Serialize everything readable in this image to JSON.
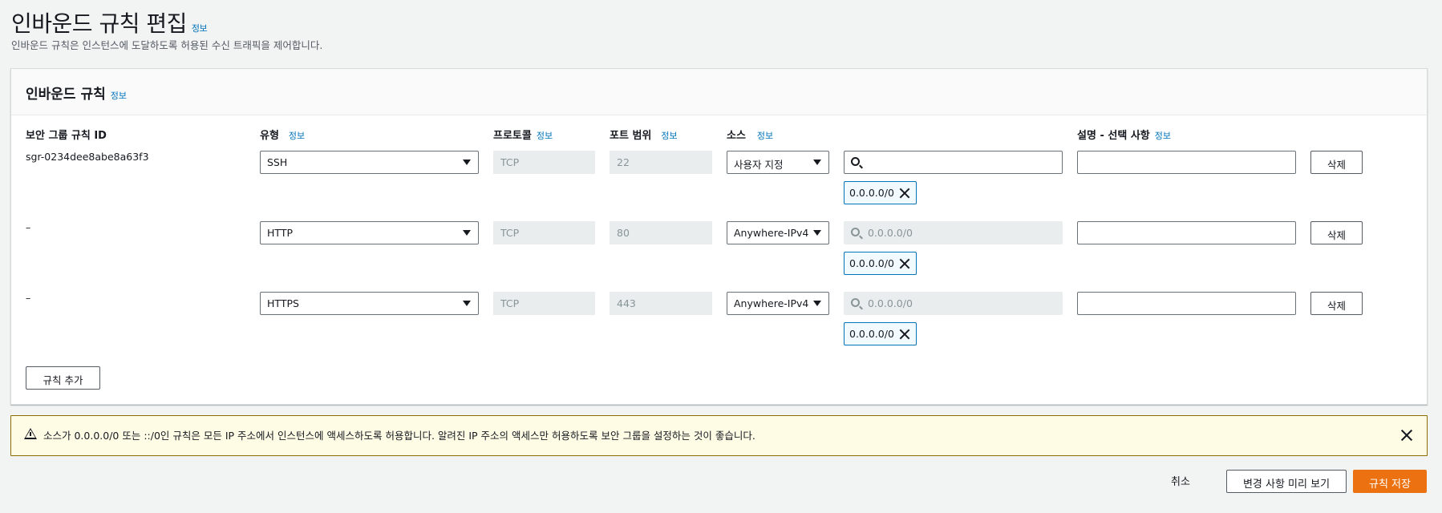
{
  "header": {
    "title": "인바운드 규칙 편집",
    "info": "정보",
    "description": "인바운드 규칙은 인스턴스에 도달하도록 허용된 수신 트래픽을 제어합니다."
  },
  "panel": {
    "title": "인바운드 규칙",
    "info": "정보",
    "columns": {
      "rule_id": "보안 그룹 규칙 ID",
      "type": "유형",
      "protocol": "프로토콜",
      "port_range": "포트 범위",
      "source": "소스",
      "description": "설명 - 선택 사항",
      "info": "정보"
    },
    "rows": [
      {
        "rule_id": "sgr-0234dee8abe8a63f3",
        "type": "SSH",
        "protocol": "TCP",
        "port": "22",
        "source": "사용자 지정",
        "search_placeholder": "",
        "token": "0.0.0.0/0",
        "delete": "삭제"
      },
      {
        "rule_id": "–",
        "type": "HTTP",
        "protocol": "TCP",
        "port": "80",
        "source": "Anywhere-IPv4",
        "search_placeholder": "0.0.0.0/0",
        "token": "0.0.0.0/0",
        "delete": "삭제"
      },
      {
        "rule_id": "–",
        "type": "HTTPS",
        "protocol": "TCP",
        "port": "443",
        "source": "Anywhere-IPv4",
        "search_placeholder": "0.0.0.0/0",
        "token": "0.0.0.0/0",
        "delete": "삭제"
      }
    ],
    "add_rule": "규칙 추가"
  },
  "warning": {
    "text": "소스가 0.0.0.0/0 또는 ::/0인 규칙은 모든 IP 주소에서 인스턴스에 액세스하도록 허용합니다. 알려진 IP 주소의 액세스만 허용하도록 보안 그룹을 설정하는 것이 좋습니다."
  },
  "footer": {
    "cancel": "취소",
    "preview": "변경 사항 미리 보기",
    "save": "규칙 저장"
  },
  "colors": {
    "link": "#0073bb",
    "primary": "#ec7211",
    "warning_bg": "#fffce6",
    "warning_border": "#8a6d00"
  }
}
